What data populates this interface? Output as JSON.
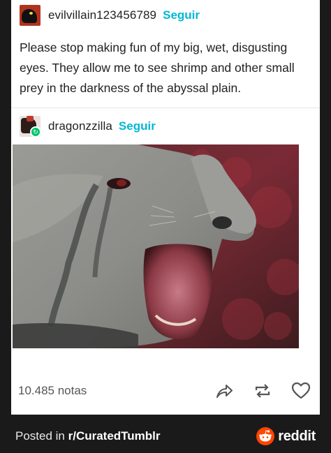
{
  "post": {
    "author": "evilvillain123456789",
    "follow_label": "Seguir",
    "text": "Please stop making fun of my big, wet, disgusting eyes. They allow me to see shrimp and other small prey in the darkness of the abyssal plain."
  },
  "reblog": {
    "author": "dragonzzilla",
    "follow_label": "Seguir",
    "image_subject": "elephant seal with open mouth"
  },
  "footer_actions": {
    "notes": "10.485 notas",
    "share_icon": "share-icon",
    "reblog_icon": "reblog-icon",
    "like_icon": "heart-icon"
  },
  "footer_bar": {
    "posted_prefix": "Posted in ",
    "subreddit": "r/CuratedTumblr",
    "brand": "reddit",
    "brand_color": "#ff4500"
  },
  "colors": {
    "follow": "#00b8d6",
    "reblog_badge": "#00c46a",
    "background": "#1a1a1b"
  }
}
